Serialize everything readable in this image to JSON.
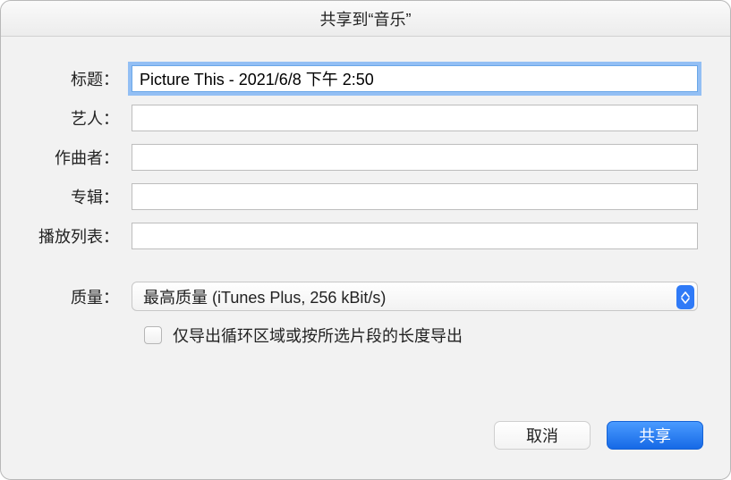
{
  "window": {
    "title": "共享到“音乐”"
  },
  "form": {
    "title_label": "标题：",
    "title_value": "Picture This - 2021/6/8 下午 2:50",
    "artist_label": "艺人：",
    "artist_value": "",
    "composer_label": "作曲者：",
    "composer_value": "",
    "album_label": "专辑：",
    "album_value": "",
    "playlist_label": "播放列表：",
    "playlist_value": "",
    "quality_label": "质量：",
    "quality_value": "最高质量 (iTunes Plus, 256 kBit/s)",
    "export_loop_checked": false,
    "export_loop_label": "仅导出循环区域或按所选片段的长度导出"
  },
  "footer": {
    "cancel": "取消",
    "share": "共享"
  }
}
